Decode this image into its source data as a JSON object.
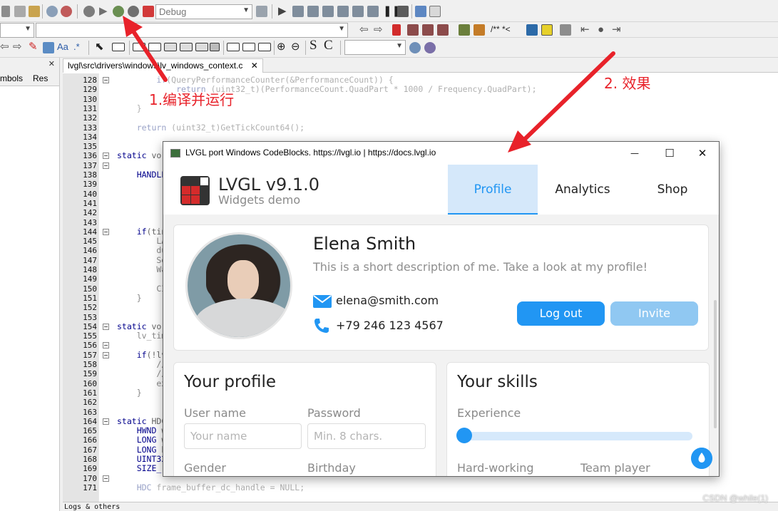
{
  "ide": {
    "build_target": "Debug",
    "file_tab": "lvgl\\src\\drivers\\windows\\lv_windows_context.c",
    "left_tabs": [
      "mbols",
      "Res"
    ],
    "logs_label": "Logs & others",
    "line_numbers": [
      128,
      129,
      130,
      131,
      132,
      133,
      134,
      135,
      136,
      137,
      138,
      139,
      140,
      141,
      142,
      143,
      144,
      145,
      146,
      147,
      148,
      149,
      150,
      151,
      152,
      153,
      154,
      155,
      156,
      157,
      158,
      159,
      160,
      161,
      162,
      163,
      164,
      165,
      166,
      167,
      168,
      169,
      170,
      171
    ],
    "code_lines": {
      "l128": "        if(QueryPerformanceCounter(&PerformanceCount)) {",
      "l129": "            return (uint32_t)(PerformanceCount.QuadPart * 1000 / Frequency.QuadPart);",
      "l131": "    }",
      "l133": "    return (uint32_t)GetTickCount64();",
      "l136": "static vo",
      "l138": "    HANDLE",
      "l144": "    if(tin",
      "l145": "        LA",
      "l146": "        du",
      "l147": "        Se",
      "l148": "        Wa",
      "l150": "        CI",
      "l151": "    }",
      "l154": "static vo",
      "l155": "    lv_tim",
      "l157": "    if(!lv",
      "l158": "        //",
      "l159": "        //",
      "l160": "        ex",
      "l161": "    }",
      "l164": "static HDC",
      "l165": "    HWND w",
      "l166": "    LONG w",
      "l167": "    LONG h",
      "l168": "    UINT32",
      "l169": "    SIZE_",
      "l171": "    HDC frame_buffer_dc_handle = NULL;"
    },
    "watermark": "CSDN @while(1)"
  },
  "annotations": {
    "step1": "1.编译并运行",
    "step2": "2. 效果",
    "arrow_color": "#e8222a"
  },
  "lvgl_window": {
    "title": "LVGL port Windows CodeBlocks.      https://lvgl.io | https://docs.lvgl.io",
    "controls": {
      "minimize": "—",
      "maximize": "☐",
      "close": "✕"
    },
    "header": {
      "title": "LVGL v9.1.0",
      "subtitle": "Widgets demo"
    },
    "tabs": [
      {
        "label": "Profile",
        "active": true
      },
      {
        "label": "Analytics",
        "active": false
      },
      {
        "label": "Shop",
        "active": false
      }
    ],
    "profile": {
      "name": "Elena Smith",
      "description": "This is a short description of me. Take a look at my profile!",
      "email": "elena@smith.com",
      "phone": "+79 246 123 4567",
      "logout_label": "Log out",
      "invite_label": "Invite"
    },
    "your_profile": {
      "title": "Your profile",
      "username_label": "User name",
      "username_placeholder": "Your name",
      "password_label": "Password",
      "password_placeholder": "Min. 8 chars.",
      "gender_label": "Gender",
      "birthday_label": "Birthday"
    },
    "your_skills": {
      "title": "Your skills",
      "experience_label": "Experience",
      "experience_value": 0,
      "hardworking_label": "Hard-working",
      "teamplayer_label": "Team player"
    },
    "accent_color": "#2196f3",
    "icons": [
      "email-icon",
      "phone-icon",
      "water-drop-icon",
      "lvgl-logo"
    ]
  }
}
